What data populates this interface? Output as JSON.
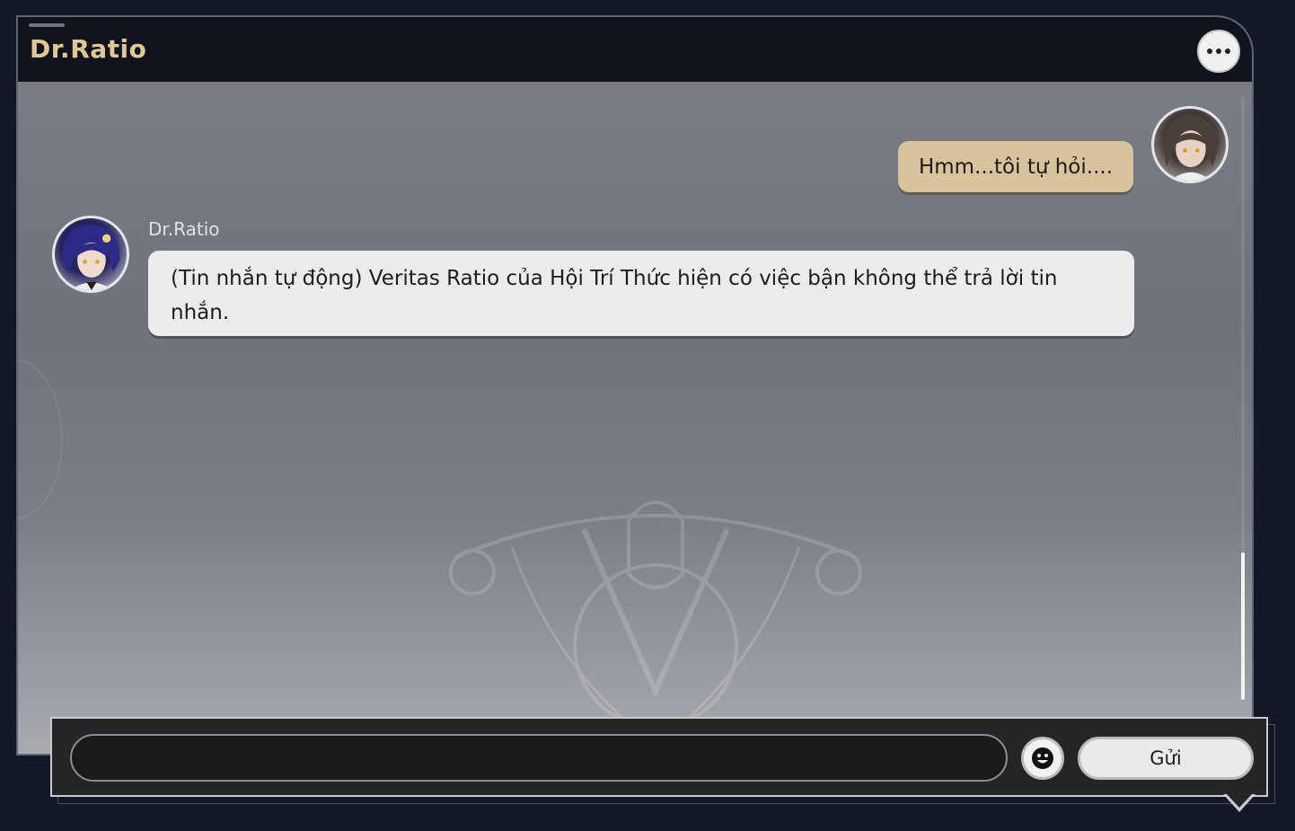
{
  "header": {
    "title": "Dr.Ratio",
    "more_icon": "more-horizontal-icon"
  },
  "messages": [
    {
      "direction": "outgoing",
      "avatar": "player-avatar",
      "text": "Hmm...tôi tự hỏi...."
    },
    {
      "direction": "incoming",
      "avatar": "dr-ratio-avatar",
      "sender": "Dr.Ratio",
      "text": "(Tin nhắn tự động) Veritas Ratio của Hội Trí Thức hiện có việc bận không thể trả lời tin nhắn."
    }
  ],
  "composer": {
    "input_value": "",
    "emoji_icon": "emoji-smile-icon",
    "send_label": "Gửi"
  },
  "colors": {
    "title_gold": "#e1c697",
    "outgoing_bubble": "#d9c39c",
    "incoming_bubble": "#ececee",
    "panel_dark": "#0f131b"
  }
}
